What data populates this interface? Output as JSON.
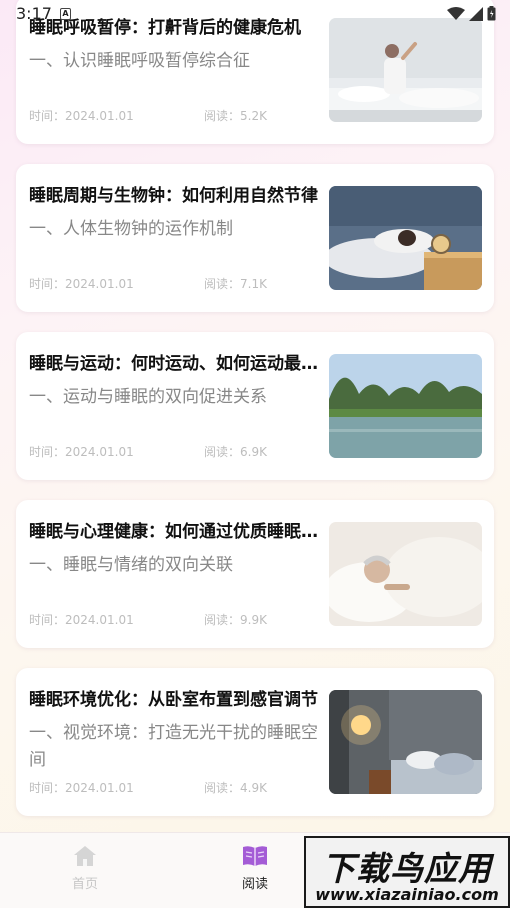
{
  "status_bar": {
    "time": "3:17",
    "notification_letter": "A"
  },
  "articles": [
    {
      "title": "睡眠呼吸暂停：打鼾背后的健康危机",
      "subtitle": "一、认识睡眠呼吸暂停综合征",
      "time_label": "时间：",
      "date": "2024.01.01",
      "reads_label": "阅读：",
      "reads": "5.2K",
      "image": "man-stretching-in-bed"
    },
    {
      "title": "睡眠周期与生物钟：如何利用自然节律",
      "subtitle": "一、人体生物钟的运作机制",
      "time_label": "时间：",
      "date": "2024.01.01",
      "reads_label": "阅读：",
      "reads": "7.1K",
      "image": "woman-sleeping-alarm-clock"
    },
    {
      "title": "睡眠与运动：何时运动、如何运动最助眠",
      "subtitle": "一、运动与睡眠的双向促进关系",
      "time_label": "时间：",
      "date": "2024.01.01",
      "reads_label": "阅读：",
      "reads": "6.9K",
      "image": "river-karst-mountains"
    },
    {
      "title": "睡眠与心理健康：如何通过优质睡眠改善情绪",
      "subtitle": "一、睡眠与情绪的双向关联",
      "time_label": "时间：",
      "date": "2024.01.01",
      "reads_label": "阅读：",
      "reads": "9.9K",
      "image": "elderly-man-sleeping"
    },
    {
      "title": "睡眠环境优化：从卧室布置到感官调节",
      "subtitle": "一、视觉环境：打造无光干扰的睡眠空间",
      "time_label": "时间：",
      "date": "2024.01.01",
      "reads_label": "阅读：",
      "reads": "4.9K",
      "image": "elderly-couple-bedroom"
    }
  ],
  "tabbar": {
    "home": {
      "label": "首页",
      "icon": "home-icon",
      "active": false
    },
    "read": {
      "label": "阅读",
      "icon": "book-icon",
      "active": true
    }
  },
  "watermark": {
    "title": "下载鸟应用",
    "url": "www.xiazainiao.com"
  },
  "colors": {
    "accent": "#a45cd6",
    "inactive": "#c7c7c7"
  }
}
